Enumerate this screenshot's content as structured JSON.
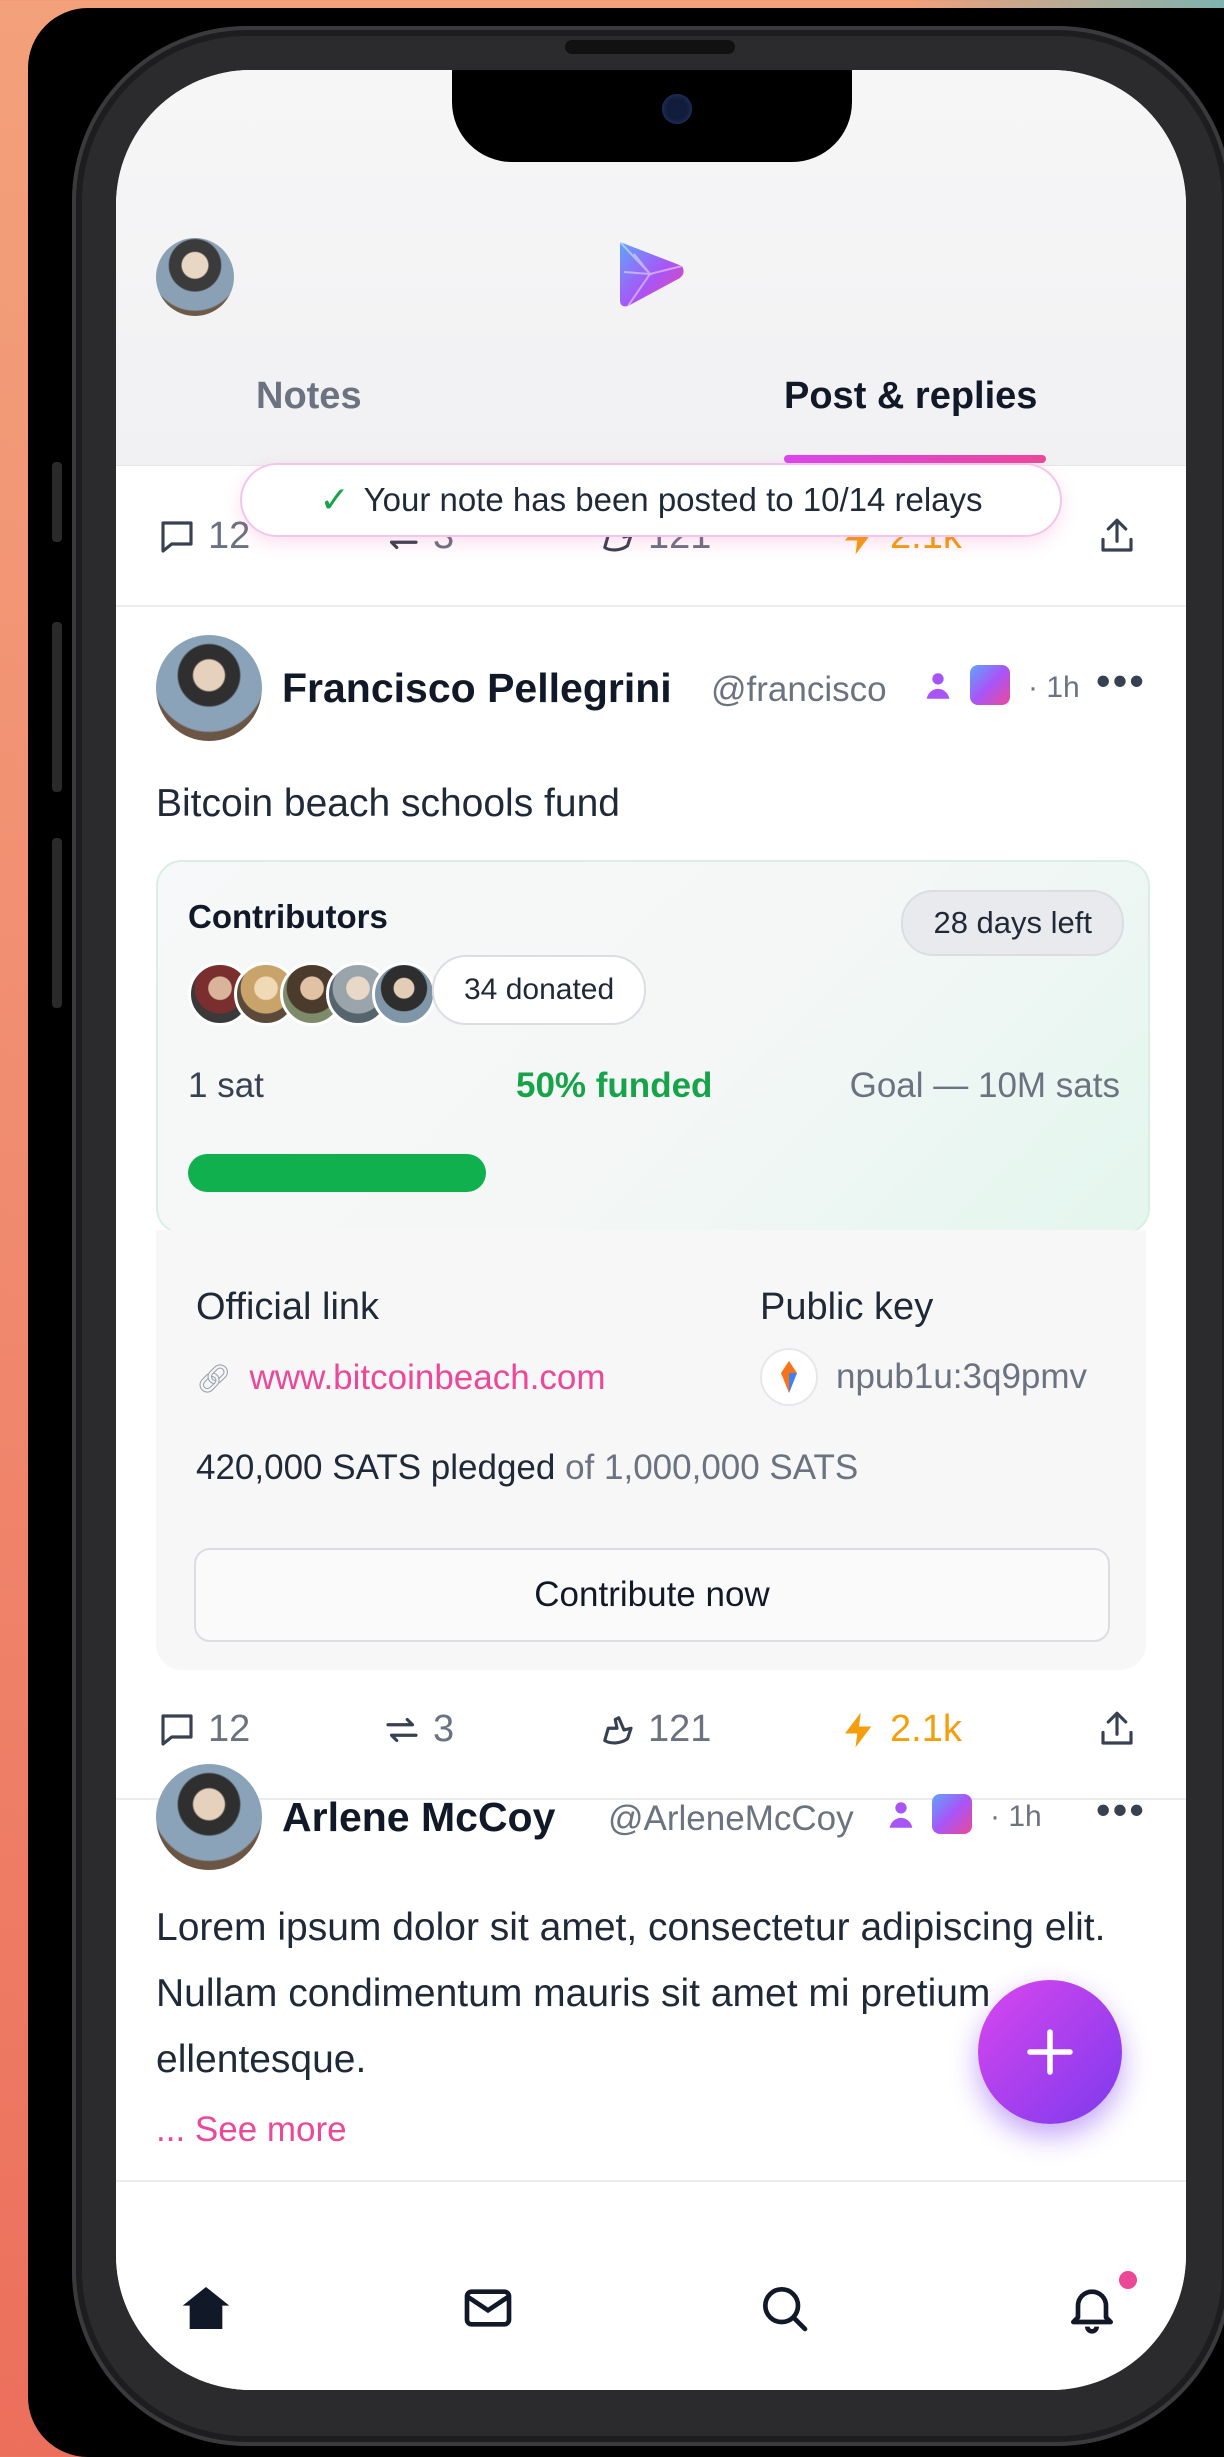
{
  "header": {
    "tabs": [
      {
        "label": "Notes",
        "active": false
      },
      {
        "label": "Post & replies",
        "active": true
      }
    ]
  },
  "toast": {
    "text": "Your note has been posted to 10/14 relays"
  },
  "top_actions": {
    "replies": "12",
    "reposts": "3",
    "likes": "121",
    "zaps": "2.1k"
  },
  "post1": {
    "author": "Francisco Pellegrini",
    "handle": "@francisco",
    "time": "· 1h",
    "text": "Bitcoin beach schools fund",
    "fund": {
      "contributors_label": "Contributors",
      "days_left": "28 days left",
      "donated": "34 donated",
      "min_label": "1 sat",
      "funded_label": "50% funded",
      "goal_label": "Goal — 10M sats",
      "progress_fraction": 0.32
    },
    "info": {
      "official_link_label": "Official link",
      "official_link": "www.bitcoinbeach.com",
      "public_key_label": "Public key",
      "public_key": "npub1u:3q9pmv",
      "pledged": "420,000 SATS pledged",
      "pledged_of": "of 1,000,000 SATS",
      "cta": "Contribute now"
    },
    "actions": {
      "replies": "12",
      "reposts": "3",
      "likes": "121",
      "zaps": "2.1k"
    }
  },
  "post2": {
    "author": "Arlene McCoy",
    "handle": "@ArleneMcCoy",
    "time": "· 1h",
    "text": "Lorem ipsum dolor sit amet, consectetur adipiscing elit. Nullam condimentum mauris sit amet mi pretium ellentesque.",
    "see_more": "... See more"
  },
  "fab": {
    "icon": "plus-icon"
  },
  "bottom_nav": [
    "home-icon",
    "mail-icon",
    "search-icon",
    "bell-icon"
  ],
  "colors": {
    "accent": "#ec4899",
    "funded": "#16a34a",
    "zap": "#f59e0b",
    "fab": "#7c3aed"
  }
}
